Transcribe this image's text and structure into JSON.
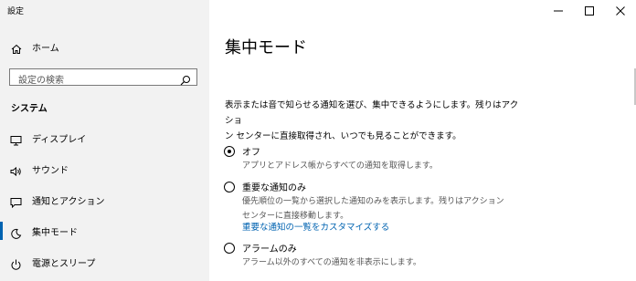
{
  "app_title": "設定",
  "sidebar": {
    "home_label": "ホーム",
    "search_placeholder": "設定の検索",
    "section_title": "システム",
    "items": [
      {
        "label": "ディスプレイ",
        "icon": "monitor-icon"
      },
      {
        "label": "サウンド",
        "icon": "speaker-icon"
      },
      {
        "label": "通知とアクション",
        "icon": "notification-icon"
      },
      {
        "label": "集中モード",
        "icon": "moon-icon",
        "active": true
      },
      {
        "label": "電源とスリープ",
        "icon": "power-icon"
      }
    ]
  },
  "window_controls": [
    "minimize",
    "maximize",
    "close"
  ],
  "main": {
    "title": "集中モード",
    "description_line1": "表示または音で知らせる通知を選び、集中できるようにします。残りはアクショ",
    "description_line2": "ン センターに直接取得され、いつでも見ることができます。",
    "options": [
      {
        "label": "オフ",
        "checked": true,
        "desc_lines": [
          "アプリとアドレス帳からすべての通知を取得します。"
        ]
      },
      {
        "label": "重要な通知のみ",
        "checked": false,
        "desc_lines": [
          "優先順位の一覧から選択した通知のみを表示します。残りはアクション",
          "センターに直接移動します。"
        ],
        "link": "重要な通知の一覧をカスタマイズする"
      },
      {
        "label": "アラームのみ",
        "checked": false,
        "desc_lines": [
          "アラーム以外のすべての通知を非表示にします。"
        ]
      }
    ]
  },
  "colors": {
    "accent": "#0063b1",
    "sidebar_bg": "#f2f2f2"
  }
}
